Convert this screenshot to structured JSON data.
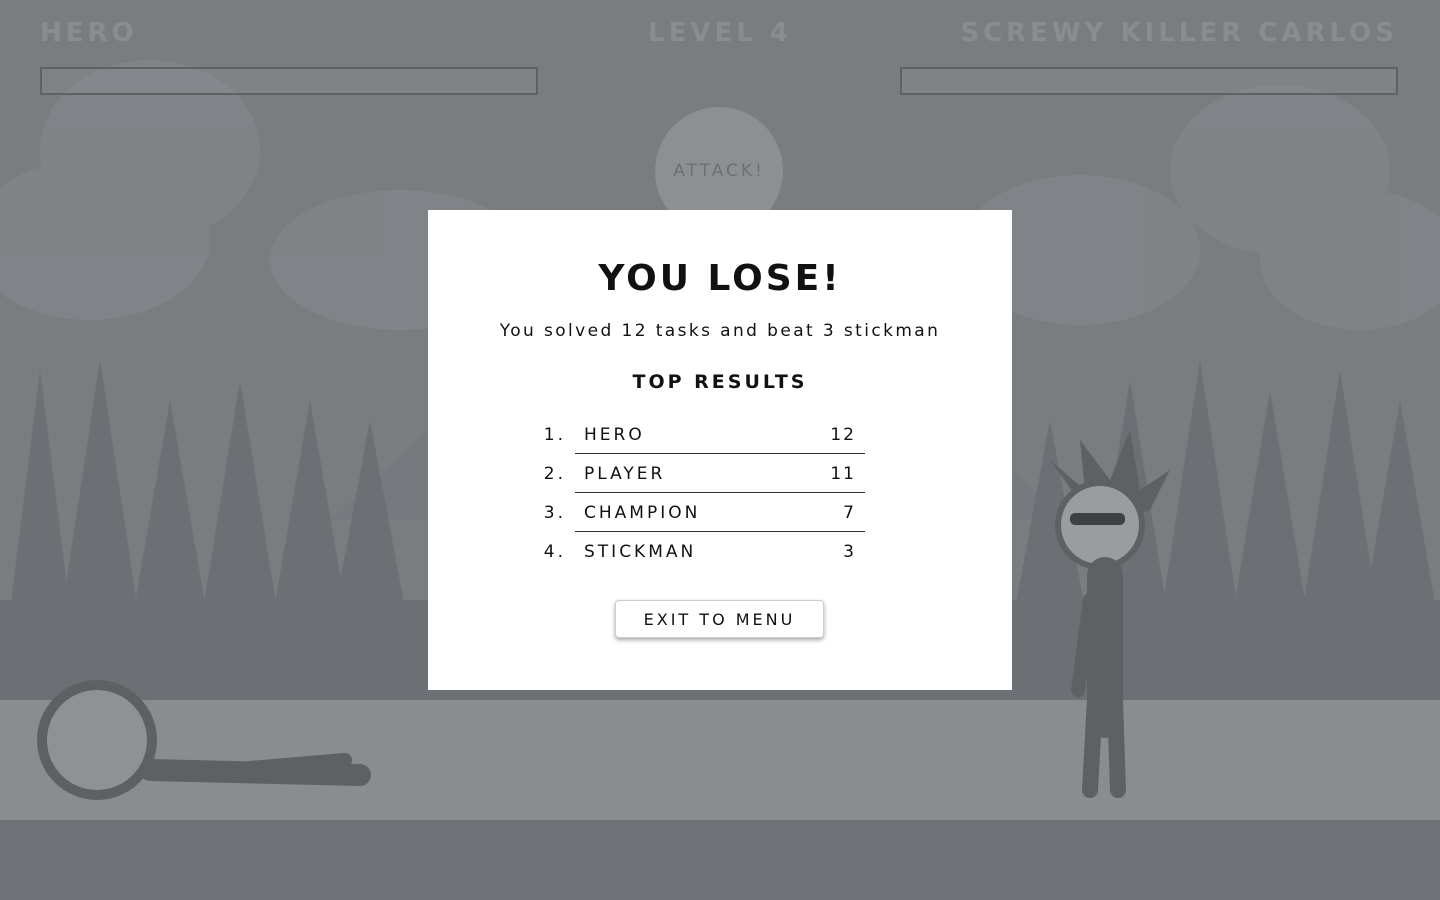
{
  "hud": {
    "player_name": "HERO",
    "level_label": "LEVEL 4",
    "enemy_name": "SCREWY KILLER CARLOS",
    "player_health": 0,
    "enemy_health": 0
  },
  "attack_button": {
    "label": "ATTACK!"
  },
  "modal": {
    "title": "YOU LOSE!",
    "summary": "You solved 12 tasks and beat 3 stickman",
    "results_title": "TOP RESULTS",
    "results": [
      {
        "rank": "1.",
        "name": "HERO",
        "score": "12"
      },
      {
        "rank": "2.",
        "name": "PLAYER",
        "score": "11"
      },
      {
        "rank": "3.",
        "name": "CHAMPION",
        "score": "7"
      },
      {
        "rank": "4.",
        "name": "STICKMAN",
        "score": "3"
      }
    ],
    "exit_label": "EXIT TO MENU"
  },
  "colors": {
    "overlay": "#7a7d80",
    "modal_background": "#ffffff",
    "text": "#111111"
  }
}
